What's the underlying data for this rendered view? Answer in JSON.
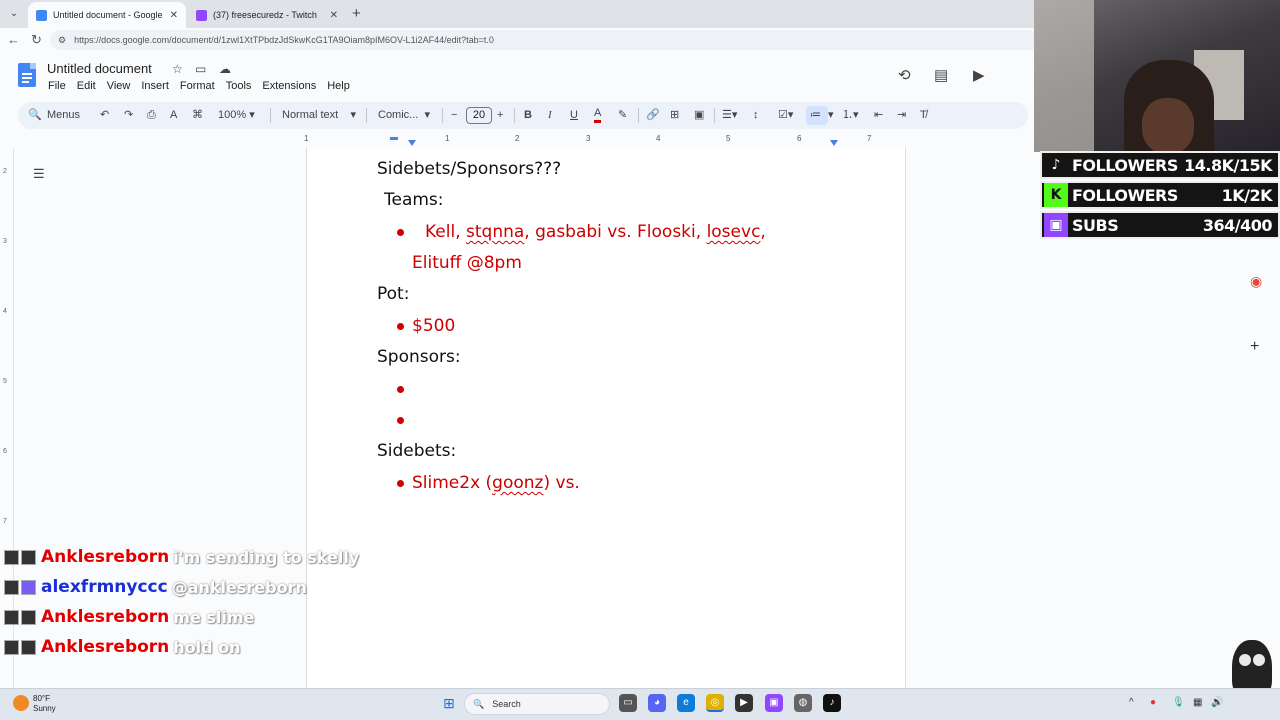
{
  "browser": {
    "tabs": [
      {
        "title": "Untitled document - Google Docs",
        "active": true
      },
      {
        "title": "(37) freesecuredz - Twitch",
        "active": false
      }
    ],
    "new_tab_icon": "+",
    "url": "https://docs.google.com/document/d/1zwl1XtTPbdzJdSkwKcG1TA9Oiam8pIM6OV-L1i2AF44/edit?tab=t.0"
  },
  "docs": {
    "title": "Untitled document",
    "menu": [
      "File",
      "Edit",
      "View",
      "Insert",
      "Format",
      "Tools",
      "Extensions",
      "Help"
    ],
    "toolbar": {
      "menus_label": "Menus",
      "zoom": "100%",
      "style": "Normal text",
      "font": "Comic...",
      "font_size": "20"
    },
    "ruler_ticks": [
      "1",
      "1",
      "2",
      "3",
      "4",
      "5",
      "6",
      "7"
    ],
    "vruler_ticks": [
      "2",
      "3",
      "4",
      "5",
      "6",
      "7"
    ]
  },
  "document": {
    "heading": "Sidebets/Sponsors???",
    "teams_label": "Teams:",
    "teams_line1_a": "Kell, ",
    "teams_line1_b": "stqnna",
    "teams_line1_c": ", gasbabi vs. Flooski, ",
    "teams_line1_d": "losevc",
    "teams_line1_e": ",",
    "teams_line2": "Elituff @8pm",
    "pot_label": "Pot:",
    "pot_value": "$500",
    "sponsors_label": "Sponsors:",
    "sidebets_label": "Sidebets:",
    "sidebet_a": "Slime2x (",
    "sidebet_b": "goonz",
    "sidebet_c": ") vs."
  },
  "stream": {
    "stats": [
      {
        "platform": "tiktok",
        "label": "FOLLOWERS",
        "value": "14.8K/15K",
        "color": "#141414"
      },
      {
        "platform": "kick",
        "label": "FOLLOWERS",
        "value": "1K/2K",
        "color": "#53fc18"
      },
      {
        "platform": "twitch",
        "label": "SUBS",
        "value": "364/400",
        "color": "#9146ff"
      }
    ],
    "chat": [
      {
        "user": "Anklesreborn",
        "message": "i'm sending to skelly",
        "color": "#e00000"
      },
      {
        "user": "alexfrmnyccc",
        "message": "@anklesreborn",
        "color": "#1a2fd6"
      },
      {
        "user": "Anklesreborn",
        "message": "me slime",
        "color": "#e00000"
      },
      {
        "user": "Anklesreborn",
        "message": "hold on",
        "color": "#e00000"
      }
    ]
  },
  "taskbar": {
    "temperature": "80°F",
    "condition": "Sunny",
    "search_label": "Search"
  }
}
